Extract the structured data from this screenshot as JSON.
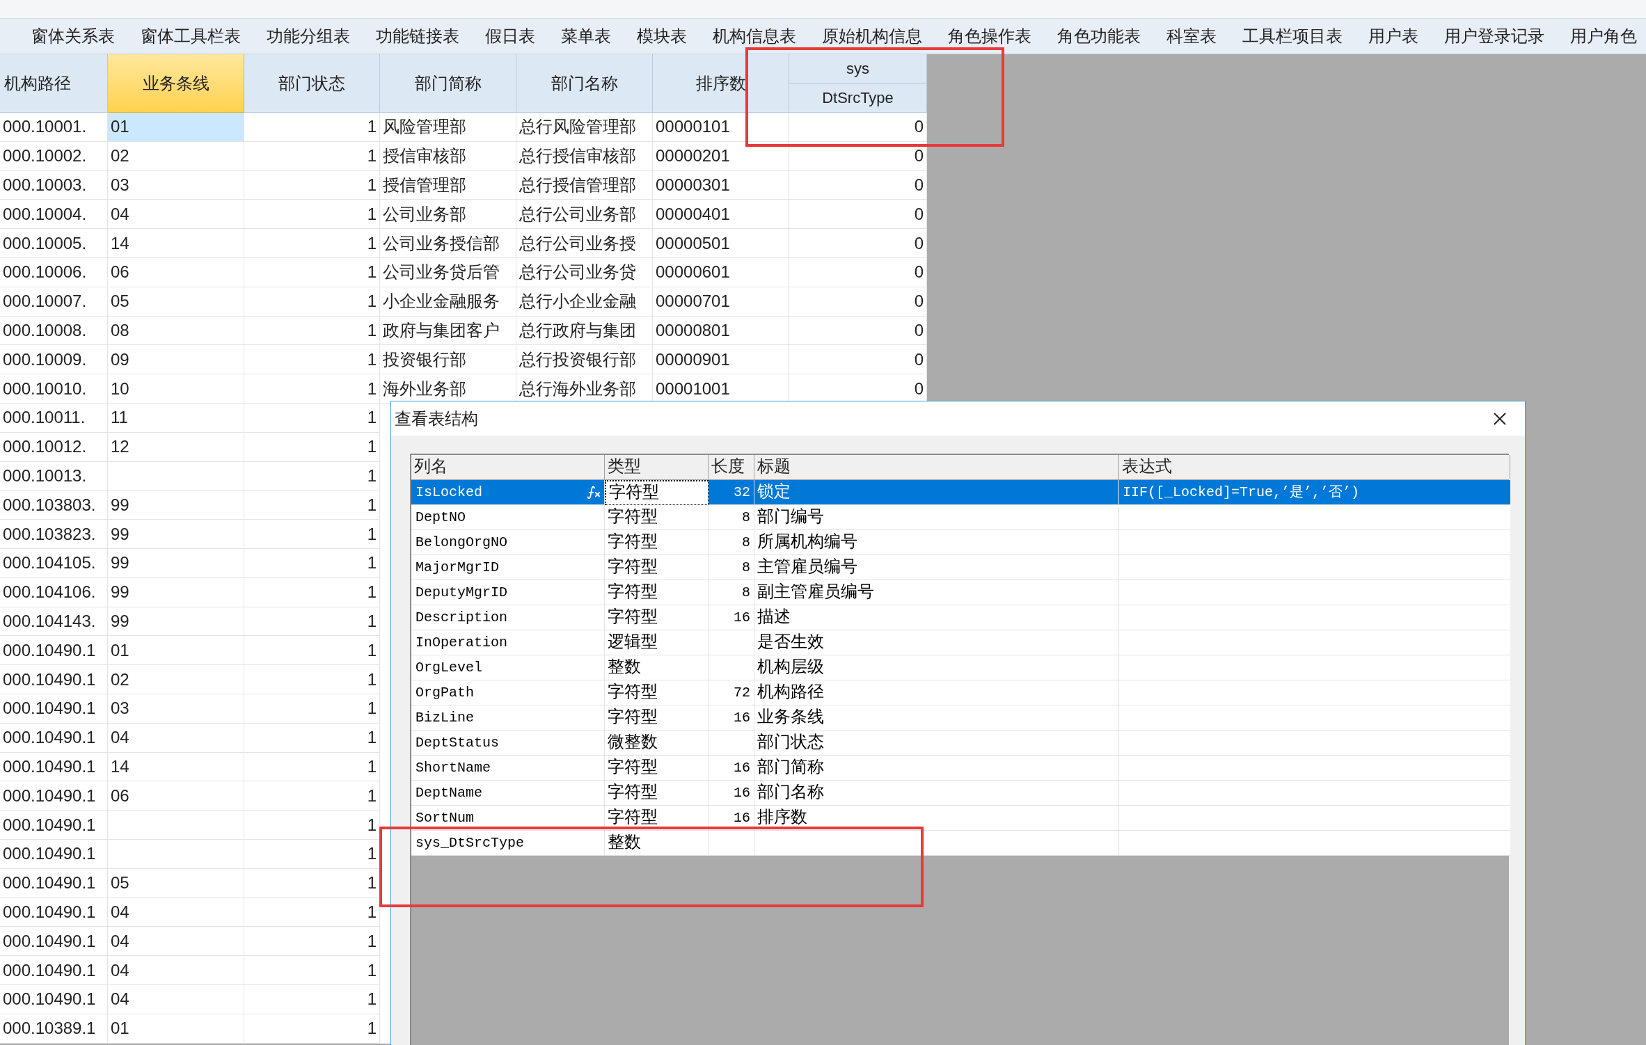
{
  "tabs": [
    {
      "label": "窗体关系表"
    },
    {
      "label": "窗体工具栏表"
    },
    {
      "label": "功能分组表"
    },
    {
      "label": "功能链接表"
    },
    {
      "label": "假日表"
    },
    {
      "label": "菜单表"
    },
    {
      "label": "模块表"
    },
    {
      "label": "机构信息表"
    },
    {
      "label": "原始机构信息"
    },
    {
      "label": "角色操作表"
    },
    {
      "label": "角色功能表"
    },
    {
      "label": "科室表"
    },
    {
      "label": "工具栏项目表"
    },
    {
      "label": "用户表"
    },
    {
      "label": "用户登录记录"
    },
    {
      "label": "用户角色"
    }
  ],
  "grid": {
    "columns": [
      {
        "label": "机构路径",
        "selected": false
      },
      {
        "label": "业务条线",
        "selected": true
      },
      {
        "label": "部门状态",
        "selected": false
      },
      {
        "label": "部门简称",
        "selected": false
      },
      {
        "label": "部门名称",
        "selected": false
      },
      {
        "label": "排序数",
        "selected": false
      },
      {
        "group": "sys",
        "label": "DtSrcType",
        "selected": false
      }
    ],
    "rows": [
      {
        "path": "000.10001.",
        "bizline": "01",
        "status": "1",
        "short": "风险管理部",
        "name": "总行风险管理部",
        "sort": "00000101",
        "sys": "0",
        "selected": true
      },
      {
        "path": "000.10002.",
        "bizline": "02",
        "status": "1",
        "short": "授信审核部",
        "name": "总行授信审核部",
        "sort": "00000201",
        "sys": "0",
        "selected": false
      },
      {
        "path": "000.10003.",
        "bizline": "03",
        "status": "1",
        "short": "授信管理部",
        "name": "总行授信管理部",
        "sort": "00000301",
        "sys": "0",
        "selected": false
      },
      {
        "path": "000.10004.",
        "bizline": "04",
        "status": "1",
        "short": "公司业务部",
        "name": "总行公司业务部",
        "sort": "00000401",
        "sys": "0",
        "selected": false
      },
      {
        "path": "000.10005.",
        "bizline": "14",
        "status": "1",
        "short": "公司业务授信部",
        "name": "总行公司业务授",
        "sort": "00000501",
        "sys": "0",
        "selected": false
      },
      {
        "path": "000.10006.",
        "bizline": "06",
        "status": "1",
        "short": "公司业务贷后管",
        "name": "总行公司业务贷",
        "sort": "00000601",
        "sys": "0",
        "selected": false
      },
      {
        "path": "000.10007.",
        "bizline": "05",
        "status": "1",
        "short": "小企业金融服务",
        "name": "总行小企业金融",
        "sort": "00000701",
        "sys": "0",
        "selected": false
      },
      {
        "path": "000.10008.",
        "bizline": "08",
        "status": "1",
        "short": "政府与集团客户",
        "name": "总行政府与集团",
        "sort": "00000801",
        "sys": "0",
        "selected": false
      },
      {
        "path": "000.10009.",
        "bizline": "09",
        "status": "1",
        "short": "投资银行部",
        "name": "总行投资银行部",
        "sort": "00000901",
        "sys": "0",
        "selected": false
      },
      {
        "path": "000.10010.",
        "bizline": "10",
        "status": "1",
        "short": "海外业务部",
        "name": "总行海外业务部",
        "sort": "00001001",
        "sys": "0",
        "selected": false
      },
      {
        "path": "000.10011.",
        "bizline": "11",
        "status": "1",
        "selected": false
      },
      {
        "path": "000.10012.",
        "bizline": "12",
        "status": "1",
        "selected": false
      },
      {
        "path": "000.10013.",
        "status": "1",
        "selected": false
      },
      {
        "path": "000.103803.",
        "bizline": "99",
        "status": "1",
        "selected": false
      },
      {
        "path": "000.103823.",
        "bizline": "99",
        "status": "1",
        "selected": false
      },
      {
        "path": "000.104105.",
        "bizline": "99",
        "status": "1",
        "selected": false
      },
      {
        "path": "000.104106.",
        "bizline": "99",
        "status": "1",
        "selected": false
      },
      {
        "path": "000.104143.",
        "bizline": "99",
        "status": "1",
        "selected": false
      },
      {
        "path": "000.10490.1",
        "bizline": "01",
        "status": "1",
        "selected": false
      },
      {
        "path": "000.10490.1",
        "bizline": "02",
        "status": "1",
        "selected": false
      },
      {
        "path": "000.10490.1",
        "bizline": "03",
        "status": "1",
        "selected": false
      },
      {
        "path": "000.10490.1",
        "bizline": "04",
        "status": "1",
        "selected": false
      },
      {
        "path": "000.10490.1",
        "bizline": "14",
        "status": "1",
        "selected": false
      },
      {
        "path": "000.10490.1",
        "bizline": "06",
        "status": "1",
        "selected": false
      },
      {
        "path": "000.10490.1",
        "status": "1",
        "selected": false
      },
      {
        "path": "000.10490.1",
        "status": "1",
        "selected": false
      },
      {
        "path": "000.10490.1",
        "bizline": "05",
        "status": "1",
        "selected": false
      },
      {
        "path": "000.10490.1",
        "bizline": "04",
        "status": "1",
        "selected": false
      },
      {
        "path": "000.10490.1",
        "bizline": "04",
        "status": "1",
        "selected": false
      },
      {
        "path": "000.10490.1",
        "bizline": "04",
        "status": "1",
        "selected": false
      },
      {
        "path": "000.10490.1",
        "bizline": "04",
        "status": "1",
        "selected": false
      },
      {
        "path": "000.10389.1",
        "bizline": "01",
        "status": "1",
        "selected": false
      }
    ]
  },
  "dialog": {
    "title": "查看表结构",
    "columns": [
      "列名",
      "类型",
      "长度",
      "标题",
      "表达式"
    ],
    "rows": [
      {
        "name": "IsLocked",
        "type": "字符型",
        "length": "32",
        "caption": "锁定",
        "expression": "IIF([_Locked]=True,’是’,’否’)",
        "fx": true,
        "selected": true,
        "focused": true
      },
      {
        "name": "DeptNO",
        "type": "字符型",
        "length": "8",
        "caption": "部门编号",
        "fx": false,
        "selected": false,
        "focused": false
      },
      {
        "name": "BelongOrgNO",
        "type": "字符型",
        "length": "8",
        "caption": "所属机构编号",
        "fx": false,
        "selected": false,
        "focused": false
      },
      {
        "name": "MajorMgrID",
        "type": "字符型",
        "length": "8",
        "caption": "主管雇员编号",
        "fx": false,
        "selected": false,
        "focused": false
      },
      {
        "name": "DeputyMgrID",
        "type": "字符型",
        "length": "8",
        "caption": "副主管雇员编号",
        "fx": false,
        "selected": false,
        "focused": false
      },
      {
        "name": "Description",
        "type": "字符型",
        "length": "16",
        "caption": "描述",
        "fx": false,
        "selected": false,
        "focused": false
      },
      {
        "name": "InOperation",
        "type": "逻辑型",
        "caption": "是否生效",
        "fx": false,
        "selected": false,
        "focused": false
      },
      {
        "name": "OrgLevel",
        "type": "整数",
        "caption": "机构层级",
        "fx": false,
        "selected": false,
        "focused": false
      },
      {
        "name": "OrgPath",
        "type": "字符型",
        "length": "72",
        "caption": "机构路径",
        "fx": false,
        "selected": false,
        "focused": false
      },
      {
        "name": "BizLine",
        "type": "字符型",
        "length": "16",
        "caption": "业务条线",
        "fx": false,
        "selected": false,
        "focused": false
      },
      {
        "name": "DeptStatus",
        "type": "微整数",
        "caption": "部门状态",
        "fx": false,
        "selected": false,
        "focused": false
      },
      {
        "name": "ShortName",
        "type": "字符型",
        "length": "16",
        "caption": "部门简称",
        "fx": false,
        "selected": false,
        "focused": false
      },
      {
        "name": "DeptName",
        "type": "字符型",
        "length": "16",
        "caption": "部门名称",
        "fx": false,
        "selected": false,
        "focused": false
      },
      {
        "name": "SortNum",
        "type": "字符型",
        "length": "16",
        "caption": "排序数",
        "fx": false,
        "selected": false,
        "focused": false
      },
      {
        "name": "sys_DtSrcType",
        "type": "整数",
        "fx": false,
        "selected": false,
        "focused": false
      }
    ]
  }
}
